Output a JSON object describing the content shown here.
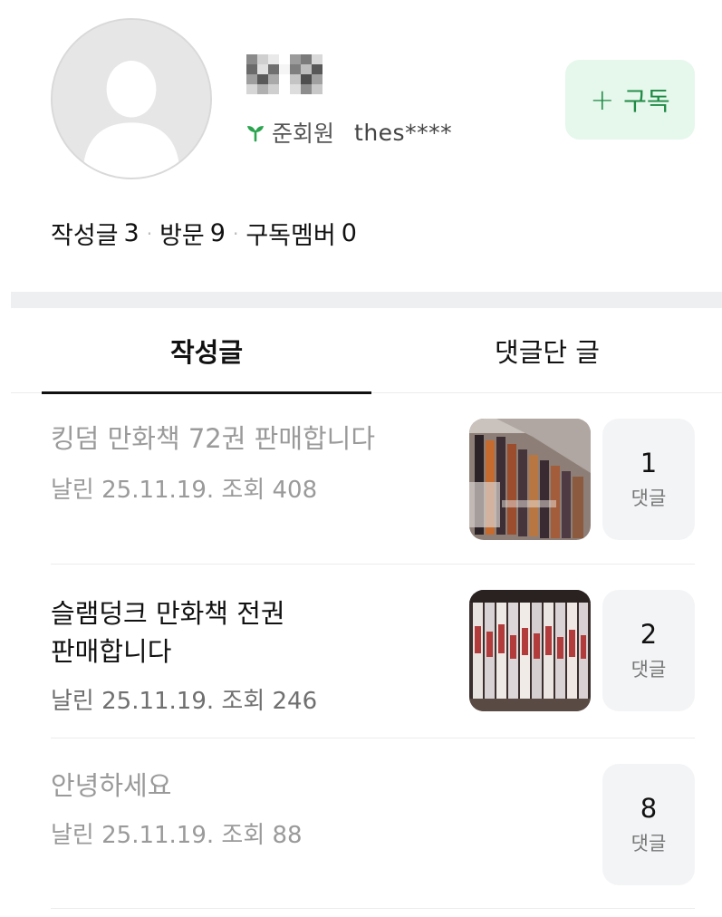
{
  "profile": {
    "avatar_icon": "default-user-avatar-icon",
    "nickname": "닉네",
    "member_icon": "sprout-icon",
    "member_grade": "준회원",
    "member_id": "thes****",
    "subscribe_icon": "plus-icon",
    "subscribe_label": "구독",
    "accent_color": "#1f8b45"
  },
  "stats": [
    {
      "label": "작성글",
      "value": "3"
    },
    {
      "label": "방문",
      "value": "9"
    },
    {
      "label": "구독멤버",
      "value": "0"
    }
  ],
  "tabs": [
    {
      "label": "작성글",
      "active": true
    },
    {
      "label": "댓글단 글",
      "active": false
    }
  ],
  "posts": [
    {
      "title_lines": [
        "킹덤 만화책 72권 판매합니다"
      ],
      "meta": "날린 25.11.19. 조회 408",
      "thumbnail": "manga-stack-photo",
      "comment_count": "1",
      "comment_label": "댓글"
    },
    {
      "title_lines": [
        "슬램덩크 만화책 전권",
        "판매합니다"
      ],
      "meta": "날린 25.11.19. 조회 246",
      "thumbnail": "slam-dunk-books-photo",
      "comment_count": "2",
      "comment_label": "댓글"
    },
    {
      "title_lines": [
        "안녕하세요"
      ],
      "meta": "날린 25.11.19. 조회 88",
      "thumbnail": null,
      "comment_count": "8",
      "comment_label": "댓글"
    }
  ]
}
